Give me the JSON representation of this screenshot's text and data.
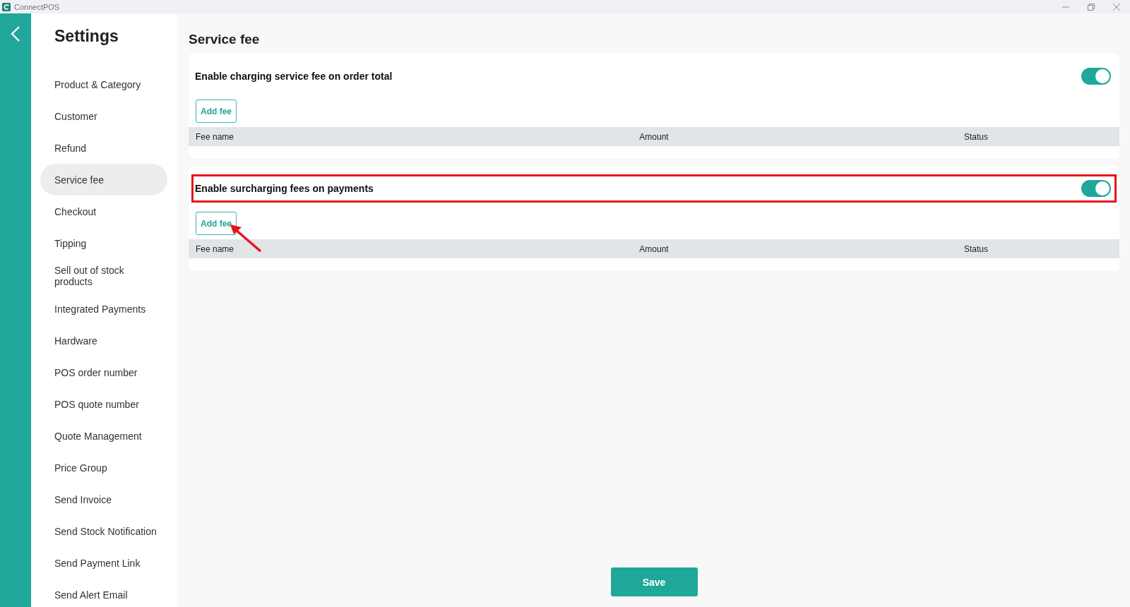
{
  "window": {
    "title": "ConnectPOS"
  },
  "sidebar": {
    "title": "Settings",
    "items": [
      {
        "label": "Product & Category",
        "selected": false
      },
      {
        "label": "Customer",
        "selected": false
      },
      {
        "label": "Refund",
        "selected": false
      },
      {
        "label": "Service fee",
        "selected": true
      },
      {
        "label": "Checkout",
        "selected": false
      },
      {
        "label": "Tipping",
        "selected": false
      },
      {
        "label": "Sell out of stock products",
        "selected": false
      },
      {
        "label": "Integrated Payments",
        "selected": false
      },
      {
        "label": "Hardware",
        "selected": false
      },
      {
        "label": "POS order number",
        "selected": false
      },
      {
        "label": "POS quote number",
        "selected": false
      },
      {
        "label": "Quote Management",
        "selected": false
      },
      {
        "label": "Price Group",
        "selected": false
      },
      {
        "label": "Send Invoice",
        "selected": false
      },
      {
        "label": "Send Stock Notification",
        "selected": false
      },
      {
        "label": "Send Payment Link",
        "selected": false
      },
      {
        "label": "Send Alert Email",
        "selected": false
      }
    ]
  },
  "page": {
    "title": "Service fee",
    "sections": [
      {
        "label": "Enable charging service fee on order total",
        "on": true,
        "highlighted": false,
        "arrow": false,
        "button": "Add fee",
        "columns": [
          "Fee name",
          "Amount",
          "Status"
        ]
      },
      {
        "label": "Enable surcharging fees on payments",
        "on": true,
        "highlighted": true,
        "arrow": true,
        "button": "Add fee",
        "columns": [
          "Fee name",
          "Amount",
          "Status"
        ]
      }
    ]
  },
  "save_button": "Save"
}
